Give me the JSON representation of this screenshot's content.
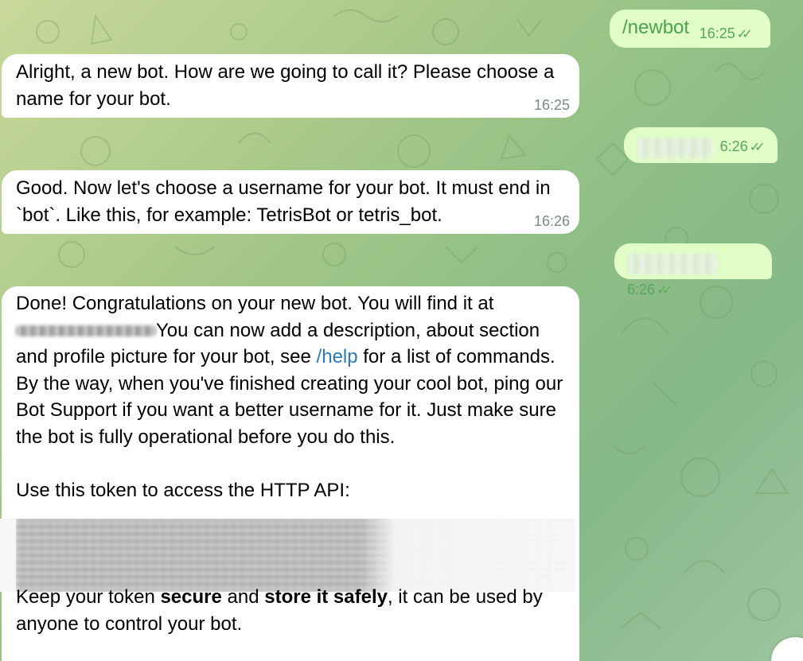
{
  "messages": [
    {
      "type": "outgoing",
      "text": "/newbot",
      "time": "16:25"
    },
    {
      "type": "incoming",
      "text": "Alright, a new bot. How are we going to call it? Please choose a name for your bot.",
      "time": "16:25"
    },
    {
      "type": "outgoing",
      "text": "",
      "time": "6:26"
    },
    {
      "type": "incoming",
      "text": "Good. Now let's choose a username for your bot. It must end in `bot`. Like this, for example: TetrisBot or tetris_bot.",
      "time": "16:26"
    },
    {
      "type": "outgoing",
      "text": "",
      "time": "6:26"
    },
    {
      "type": "incoming",
      "line1": "Done! Congratulations on your new bot. You will find it at",
      "after_link": "You can now add a description, about section and profile picture for your bot, see",
      "help": "/help",
      "rest": " for a list of commands. By the way, when you've finished creating your cool bot, ping our Bot Support if you want a better username for it. Just make sure the bot is fully operational before you do this.",
      "token_intro": "Use this token to access the HTTP API:",
      "keep_prefix": "Keep your token ",
      "secure": "secure",
      "and": " and ",
      "store": "store it safely",
      "keep_suffix": ", it can be used by anyone to control your bot."
    }
  ],
  "colors": {
    "incoming_bg": "#ffffff",
    "outgoing_bg": "#e1fec6",
    "outgoing_text": "#4aa14e",
    "link": "#2a7ab8"
  }
}
